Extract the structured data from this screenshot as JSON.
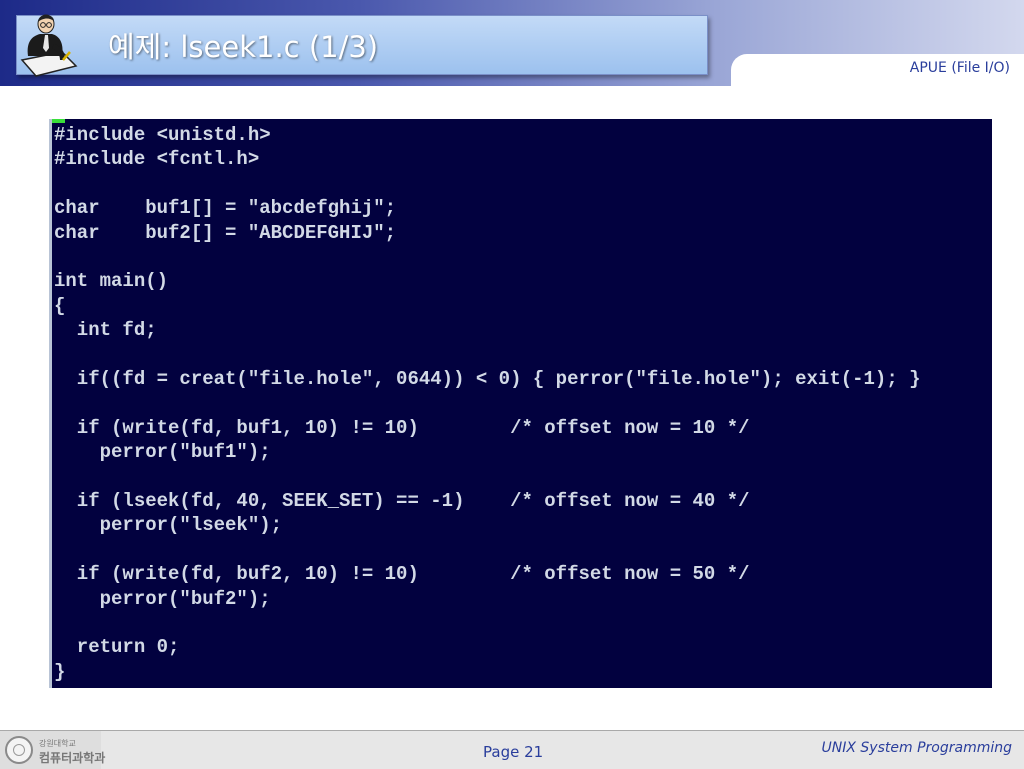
{
  "header": {
    "title": "예제: lseek1.c (1/3)",
    "topic": "APUE (File I/O)",
    "logo_icon": "professor-at-desk-icon"
  },
  "code": {
    "lines": [
      "#include <unistd.h>",
      "#include <fcntl.h>",
      "",
      "char    buf1[] = \"abcdefghij\";",
      "char    buf2[] = \"ABCDEFGHIJ\";",
      "",
      "int main()",
      "{",
      "  int fd;",
      "",
      "  if((fd = creat(\"file.hole\", 0644)) < 0) { perror(\"file.hole\"); exit(-1); }",
      "",
      "  if (write(fd, buf1, 10) != 10)        /* offset now = 10 */",
      "    perror(\"buf1\");",
      "",
      "  if (lseek(fd, 40, SEEK_SET) == -1)    /* offset now = 40 */",
      "    perror(\"lseek\");",
      "",
      "  if (write(fd, buf2, 10) != 10)        /* offset now = 50 */",
      "    perror(\"buf2\");",
      "",
      "  return 0;",
      "}"
    ]
  },
  "footer": {
    "university_line1": "강원대학교",
    "university_line2": "컴퓨터과학과",
    "page": "Page 21",
    "course": "UNIX System Programming"
  },
  "colors": {
    "code_background": "#02013f",
    "code_text": "#d2d9e6",
    "accent_text": "#2a3e9c",
    "cursor": "#3adf3a"
  }
}
